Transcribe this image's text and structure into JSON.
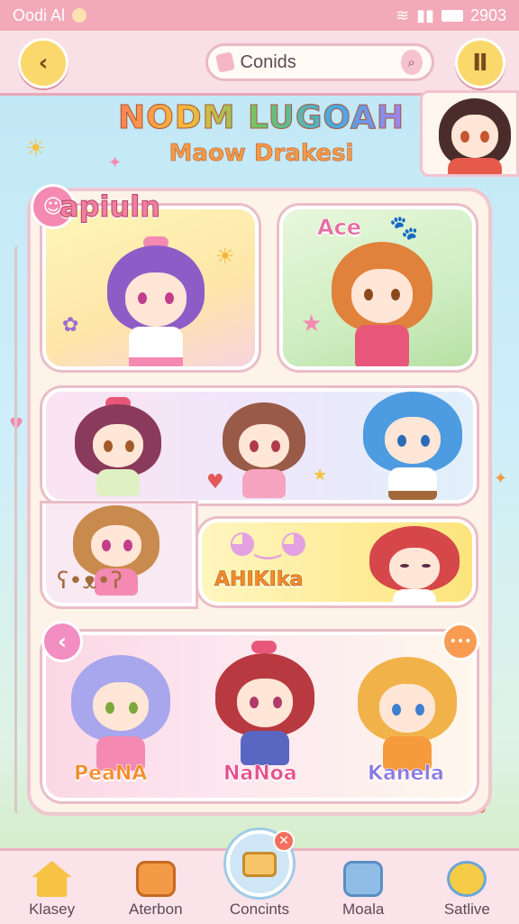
{
  "status_bar": {
    "left_text": "Oodi Al",
    "right_text": "2903"
  },
  "header": {
    "search": {
      "value": "Conids"
    },
    "back_glyph": "‹",
    "menu_glyph": "Ⅱ"
  },
  "title": {
    "main": "NODM LUGOAH",
    "sub": "Maow Drakesi"
  },
  "cards": {
    "a_label": "apiuln",
    "b_label": "Ace",
    "e_label": "AHIKIka",
    "f_labels": [
      "PeaNA",
      "NaNoa",
      "Kanela"
    ]
  },
  "panel": {
    "prev_glyph": "‹",
    "more_glyph": "•••"
  },
  "tabbar": {
    "items": [
      {
        "label": "Klasey",
        "icon": "house-icon",
        "color": "#f6c344"
      },
      {
        "label": "Aterbon",
        "icon": "box-icon",
        "color": "#f29a45"
      },
      {
        "label": "Concints",
        "icon": "chest-icon",
        "color": "#f7c567"
      },
      {
        "label": "Moala",
        "icon": "radio-icon",
        "color": "#8fbde6"
      },
      {
        "label": "Satlive",
        "icon": "face-icon",
        "color": "#f6cc47"
      }
    ]
  },
  "colors": {
    "accent_pink": "#f2a9b8",
    "accent_yellow": "#fbd86b"
  }
}
